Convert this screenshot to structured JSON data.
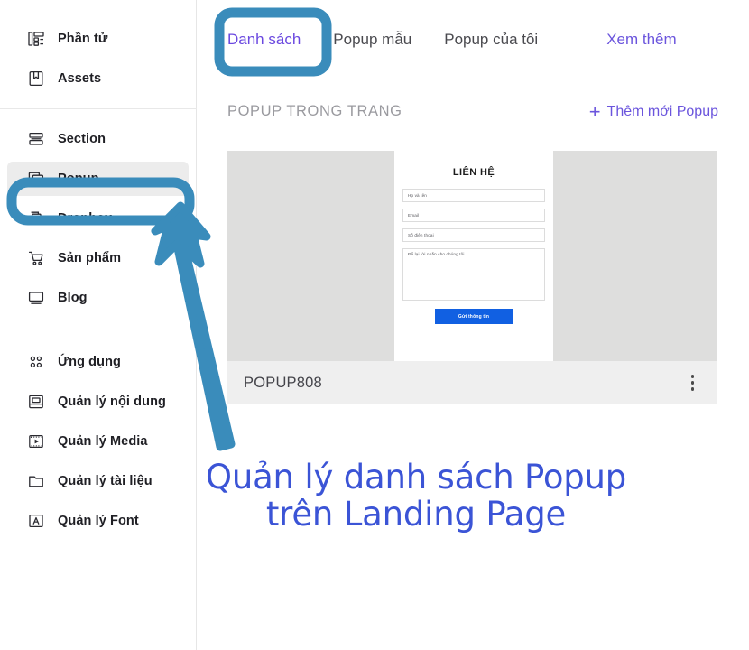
{
  "sidebar": {
    "groups": [
      {
        "items": [
          {
            "label": "Phần tử",
            "icon": "elements-icon",
            "selected": false
          },
          {
            "label": "Assets",
            "icon": "assets-bookmark-icon",
            "selected": false
          }
        ]
      },
      {
        "items": [
          {
            "label": "Section",
            "icon": "section-icon",
            "selected": false
          },
          {
            "label": "Popup",
            "icon": "popup-window-icon",
            "selected": true
          },
          {
            "label": "Dropbox",
            "icon": "dropbox-document-icon",
            "selected": false
          },
          {
            "label": "Sản phẩm",
            "icon": "cart-icon",
            "selected": false
          },
          {
            "label": "Blog",
            "icon": "monitor-icon",
            "selected": false
          }
        ]
      },
      {
        "items": [
          {
            "label": "Ứng dụng",
            "icon": "apps-grid-icon",
            "selected": false
          },
          {
            "label": "Quản lý nội dung",
            "icon": "content-inbox-icon",
            "selected": false
          },
          {
            "label": "Quản lý Media",
            "icon": "media-play-icon",
            "selected": false
          },
          {
            "label": "Quản lý tài liệu",
            "icon": "folder-icon",
            "selected": false
          },
          {
            "label": "Quản lý Font",
            "icon": "font-a-icon",
            "selected": false
          }
        ]
      }
    ]
  },
  "tabs": [
    {
      "label": "Danh sách",
      "active": true
    },
    {
      "label": "Popup mẫu",
      "active": false
    },
    {
      "label": "Popup của tôi",
      "active": false
    },
    {
      "label": "Xem thêm",
      "active": false,
      "style": "link"
    }
  ],
  "content": {
    "section_title": "POPUP TRONG TRANG",
    "add_new_label": "Thêm mới Popup",
    "add_new_plus": "+"
  },
  "card": {
    "name": "POPUP808",
    "menu_icon": "kebab-menu-icon",
    "preview": {
      "title": "LIÊN HỆ",
      "fields": [
        "Họ và tên",
        "Email",
        "Số điện thoại"
      ],
      "textarea": "Để lại lời nhắn cho chúng tôi",
      "submit_label": "Gửi thông tin"
    }
  },
  "annotations": {
    "caption_line1": "Quản lý danh sách Popup",
    "caption_line2": "trên Landing Page",
    "highlight_color": "#3a8cbb",
    "caption_color": "#3b54d6",
    "accent_purple": "#6b49e0",
    "submit_blue": "#1160e2"
  }
}
